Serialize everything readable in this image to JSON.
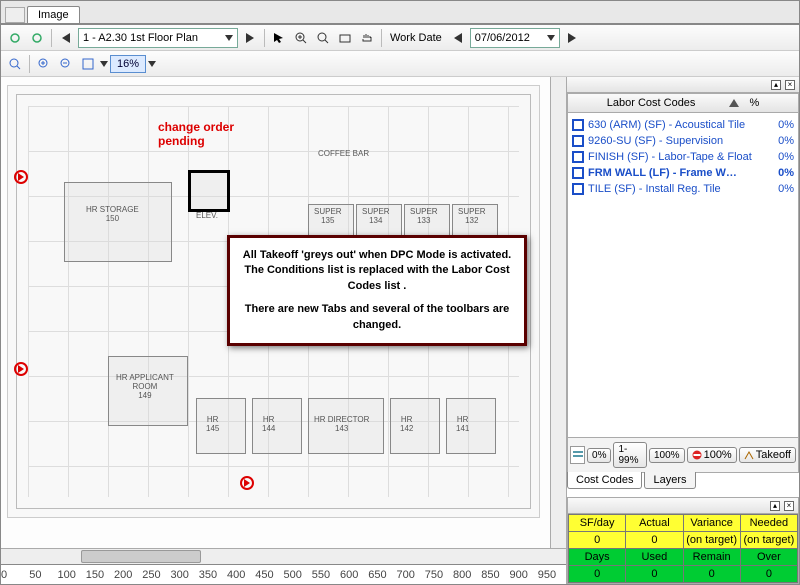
{
  "tabs": {
    "active": "Image"
  },
  "toolbar1": {
    "sheet": "1 - A2.30 1st Floor Plan",
    "workdate_label": "Work Date",
    "workdate_value": "07/06/2012"
  },
  "toolbar2": {
    "zoom": "16%"
  },
  "annotation": {
    "change_order": "change order\npending"
  },
  "modal": {
    "p1": "All Takeoff 'greys out' when DPC Mode is activated.  The Conditions list is replaced with the Labor Cost Codes list .",
    "p2": "There are new Tabs and several of the toolbars are changed."
  },
  "ruler_x": [
    "0",
    "50",
    "100",
    "150",
    "200",
    "250",
    "300",
    "350",
    "400",
    "450",
    "500",
    "550",
    "600",
    "650",
    "700",
    "750",
    "800",
    "850",
    "900",
    "950"
  ],
  "side": {
    "title": "Labor Cost Codes",
    "pct_header": "%",
    "items": [
      {
        "label": "630 (ARM) (SF) - Acoustical Tile",
        "pct": "0%",
        "bold": false
      },
      {
        "label": "9260-SU (SF) - Supervision",
        "pct": "0%",
        "bold": false
      },
      {
        "label": "FINISH (SF) - Labor-Tape & Float",
        "pct": "0%",
        "bold": false
      },
      {
        "label": "FRM WALL (LF) - Frame W…",
        "pct": "0%",
        "bold": true
      },
      {
        "label": "TILE (SF) - Install Reg. Tile",
        "pct": "0%",
        "bold": false
      }
    ],
    "filters": {
      "b1": "0%",
      "b2": "1-99%",
      "b3": "100%",
      "b4": "100%",
      "b5": "Takeoff"
    },
    "tabs": {
      "t1": "Cost Codes",
      "t2": "Layers"
    }
  },
  "metrics": {
    "row1": {
      "c1": "SF/day",
      "c2": "Actual",
      "c3": "Variance",
      "c4": "Needed"
    },
    "row2": {
      "c1": "0",
      "c2": "0",
      "c3": "(on target)",
      "c4": "(on target)"
    },
    "row3": {
      "c1": "Days",
      "c2": "Used",
      "c3": "Remain",
      "c4": "Over"
    },
    "row4": {
      "c1": "0",
      "c2": "0",
      "c3": "0",
      "c4": "0"
    }
  },
  "rooms": {
    "hr_storage": "HR STORAGE\n150",
    "elev": "ELEV.",
    "coffee": "COFFEE BAR",
    "hr_applicant": "HR APPLICANT\nROOM\n149",
    "hr145": "HR\n145",
    "hr144": "HR\n144",
    "hr_director": "HR DIRECTOR\n143",
    "hr142": "HR\n142",
    "hr141": "HR\n141",
    "super135": "SUPER\n135",
    "super134": "SUPER\n134",
    "super133": "SUPER\n133",
    "super132": "SUPER\n132"
  }
}
